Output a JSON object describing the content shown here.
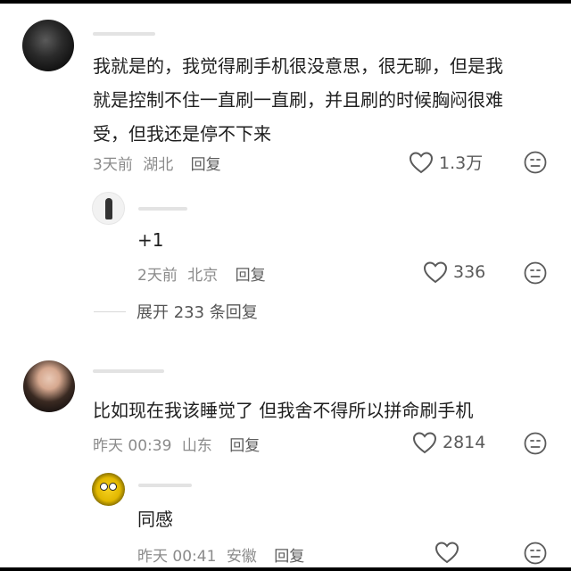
{
  "comments": [
    {
      "avatar_icon": "user-avatar-dark",
      "lines": [
        "我就是的，我觉得刷手机很没意思，很无聊，但是我",
        "就是控制不住一直刷一直刷，并且刷的时候胸闷很难",
        "受，但我还是停不下来"
      ],
      "time": "3天前",
      "location": "湖北",
      "reply_label": "回复",
      "likes": "1.3万",
      "replies": [
        {
          "avatar_icon": "user-avatar-figure",
          "text": "+1",
          "time": "2天前",
          "location": "北京",
          "reply_label": "回复",
          "likes": "336"
        }
      ],
      "expand_label": "展开 233 条回复"
    },
    {
      "avatar_icon": "user-avatar-girl",
      "lines": [
        "比如现在我该睡觉了  但我舍不得所以拼命刷手机"
      ],
      "time": "昨天 00:39",
      "location": "山东",
      "reply_label": "回复",
      "likes": "2814",
      "replies": [
        {
          "avatar_icon": "user-avatar-cartoon",
          "text": "同感",
          "time": "昨天 00:41",
          "location": "安徽",
          "reply_label": "回复",
          "likes": ""
        }
      ]
    }
  ],
  "colors": {
    "text": "#1f1f1f",
    "meta": "#8b8b8b",
    "icon": "#5a5a5a"
  }
}
